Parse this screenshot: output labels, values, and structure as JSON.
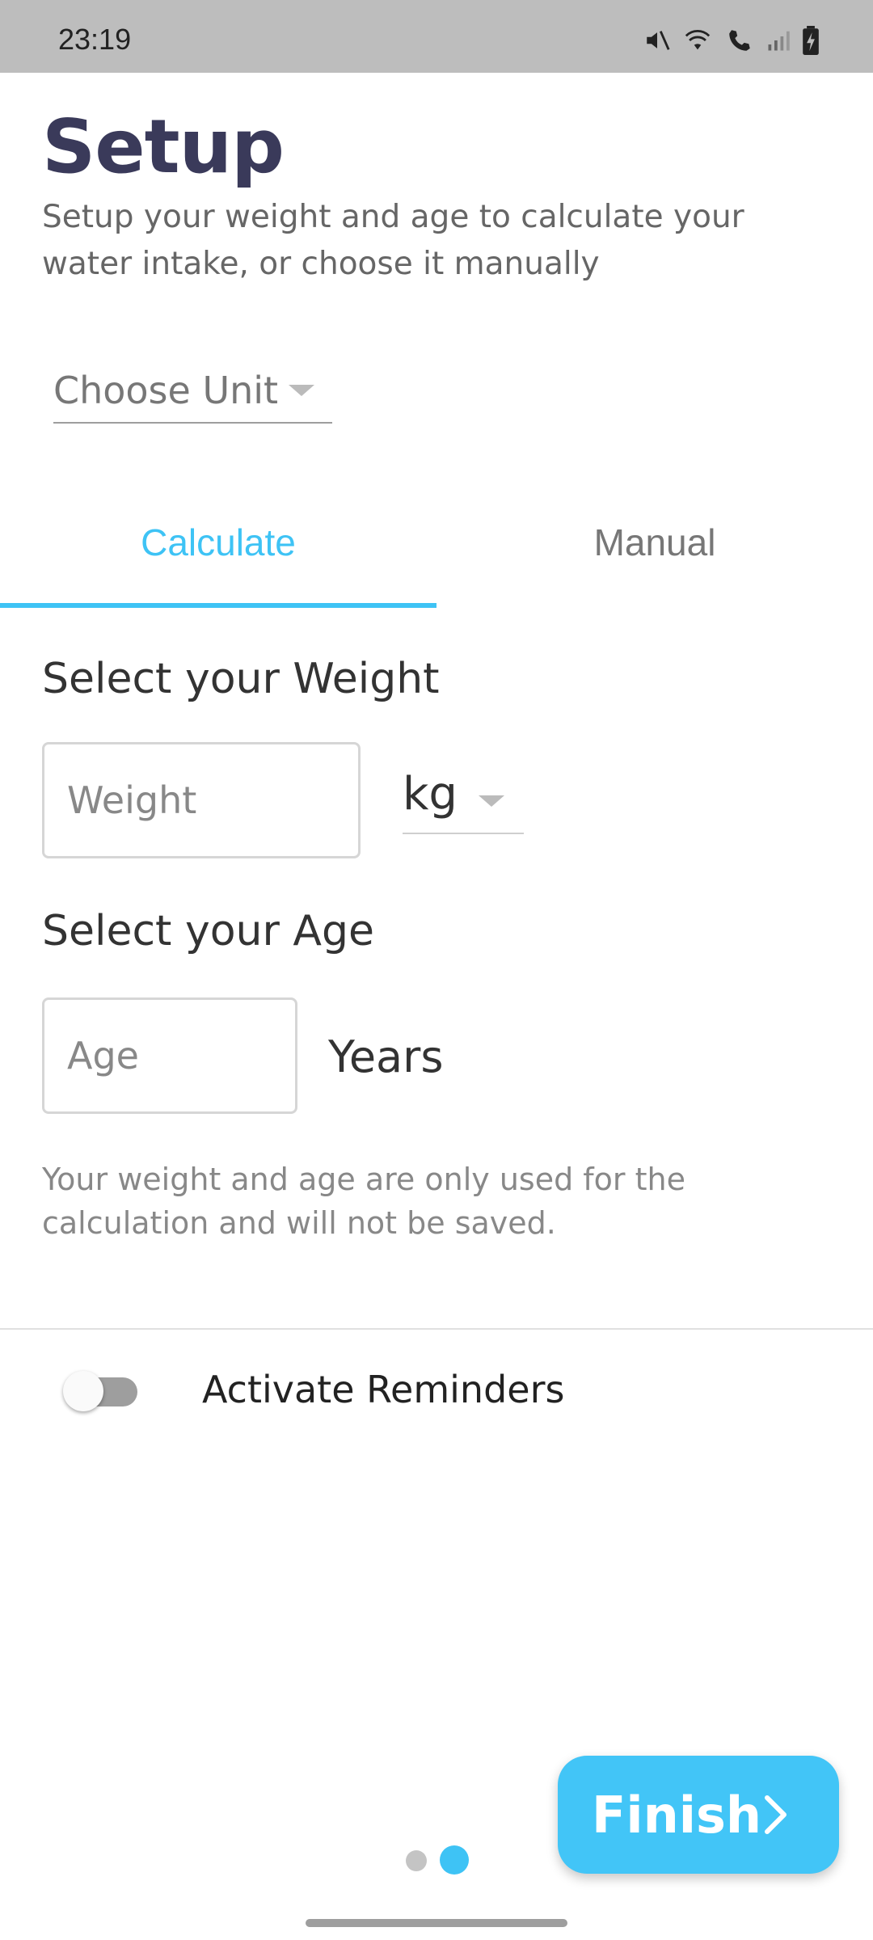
{
  "status_bar": {
    "time": "23:19",
    "icons": [
      "mute-icon",
      "wifi-icon",
      "wifi-calling-icon",
      "signal-icon",
      "battery-charging-icon"
    ]
  },
  "header": {
    "title": "Setup",
    "subtitle": "Setup your weight and age to calculate your water intake, or choose it manually"
  },
  "unit_select": {
    "label": "Choose Unit"
  },
  "tabs": [
    {
      "label": "Calculate",
      "selected": true
    },
    {
      "label": "Manual",
      "selected": false
    }
  ],
  "calculate": {
    "weight_heading": "Select your Weight",
    "weight_placeholder": "Weight",
    "weight_unit": "kg",
    "age_heading": "Select your Age",
    "age_placeholder": "Age",
    "age_unit": "Years",
    "note": "Your weight and age are only used for the calculation and will not be saved."
  },
  "reminders": {
    "label": "Activate Reminders",
    "enabled": false
  },
  "pager": {
    "count": 2,
    "active_index": 1
  },
  "finish_button": {
    "label": "Finish"
  },
  "colors": {
    "accent": "#3ec3f5",
    "title": "#3a3a5a",
    "status_bar": "#bdbdbd"
  }
}
